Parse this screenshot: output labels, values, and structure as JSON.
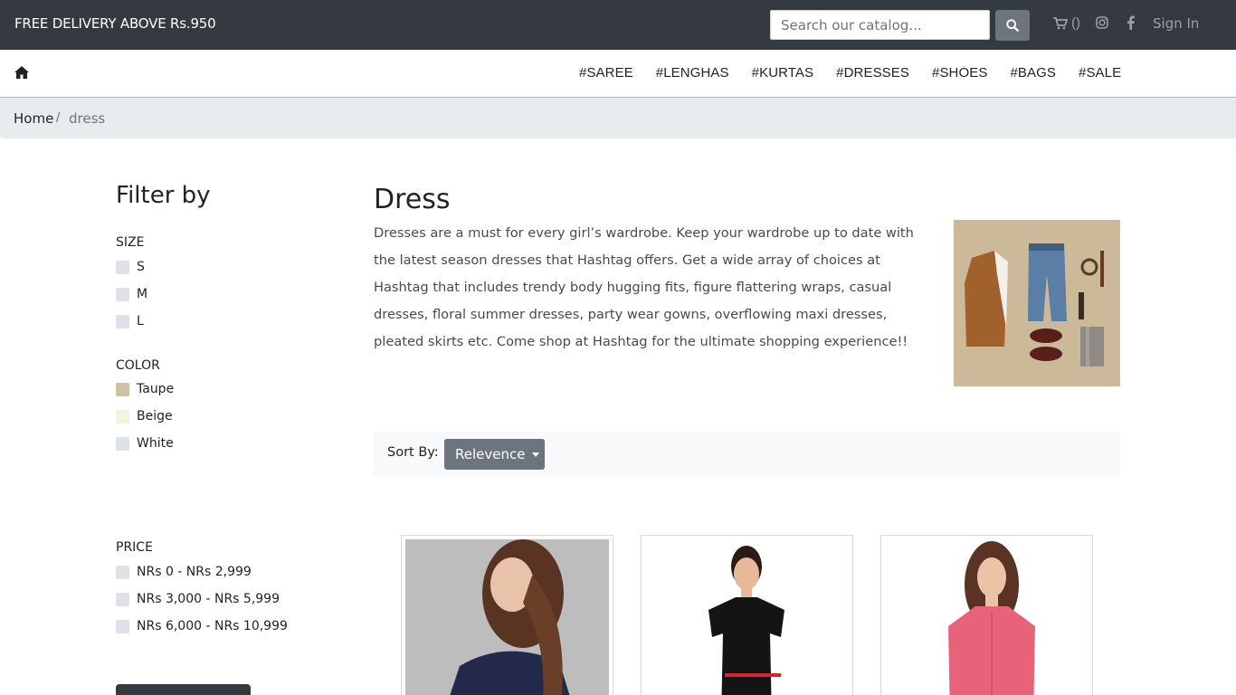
{
  "topbar": {
    "promo": "FREE DELIVERY ABOVE Rs.950",
    "search_placeholder": "Search our catalog...",
    "cart_count": "()",
    "signin": "Sign In"
  },
  "nav": {
    "links": [
      "#SAREE",
      "#LENGHAS",
      "#KURTAS",
      "#DRESSES",
      "#SHOES",
      "#BAGS",
      "#SALE"
    ]
  },
  "breadcrumb": {
    "home": "Home",
    "separator": "/",
    "current": "dress"
  },
  "filters": {
    "title": "Filter by",
    "size": {
      "label": "SIZE",
      "options": [
        "S",
        "M",
        "L"
      ]
    },
    "color": {
      "label": "COLOR",
      "options": [
        {
          "name": "Taupe",
          "swatch": "#cdc3a3"
        },
        {
          "name": "Beige",
          "swatch": "#f4f4dc"
        },
        {
          "name": "White",
          "swatch": "#dee2e6"
        }
      ]
    },
    "price": {
      "label": "PRICE",
      "options": [
        "NRs 0 - NRs 2,999",
        "NRs 3,000 - NRs 5,999",
        "NRs 6,000 - NRs 10,999"
      ]
    }
  },
  "category": {
    "title": "Dress",
    "description": "Dresses are a must for every girl’s wardrobe. Keep your wardrobe up to date with the latest season dresses that Hashtag offers. Get a wide array of choices at Hashtag that includes trendy body hugging fits, figure flattering wraps, casual dresses, floral summer dresses, party wear gowns, overflowing maxi dresses, pleated skirts etc. Come shop at Hashtag for the ultimate shopping experience!!"
  },
  "sort": {
    "label": "Sort By:",
    "selected": "Relevence"
  },
  "colors": {
    "topbar": "#343a40",
    "breadcrumb_bg": "#e9ecef",
    "button_secondary": "#6c757d"
  }
}
